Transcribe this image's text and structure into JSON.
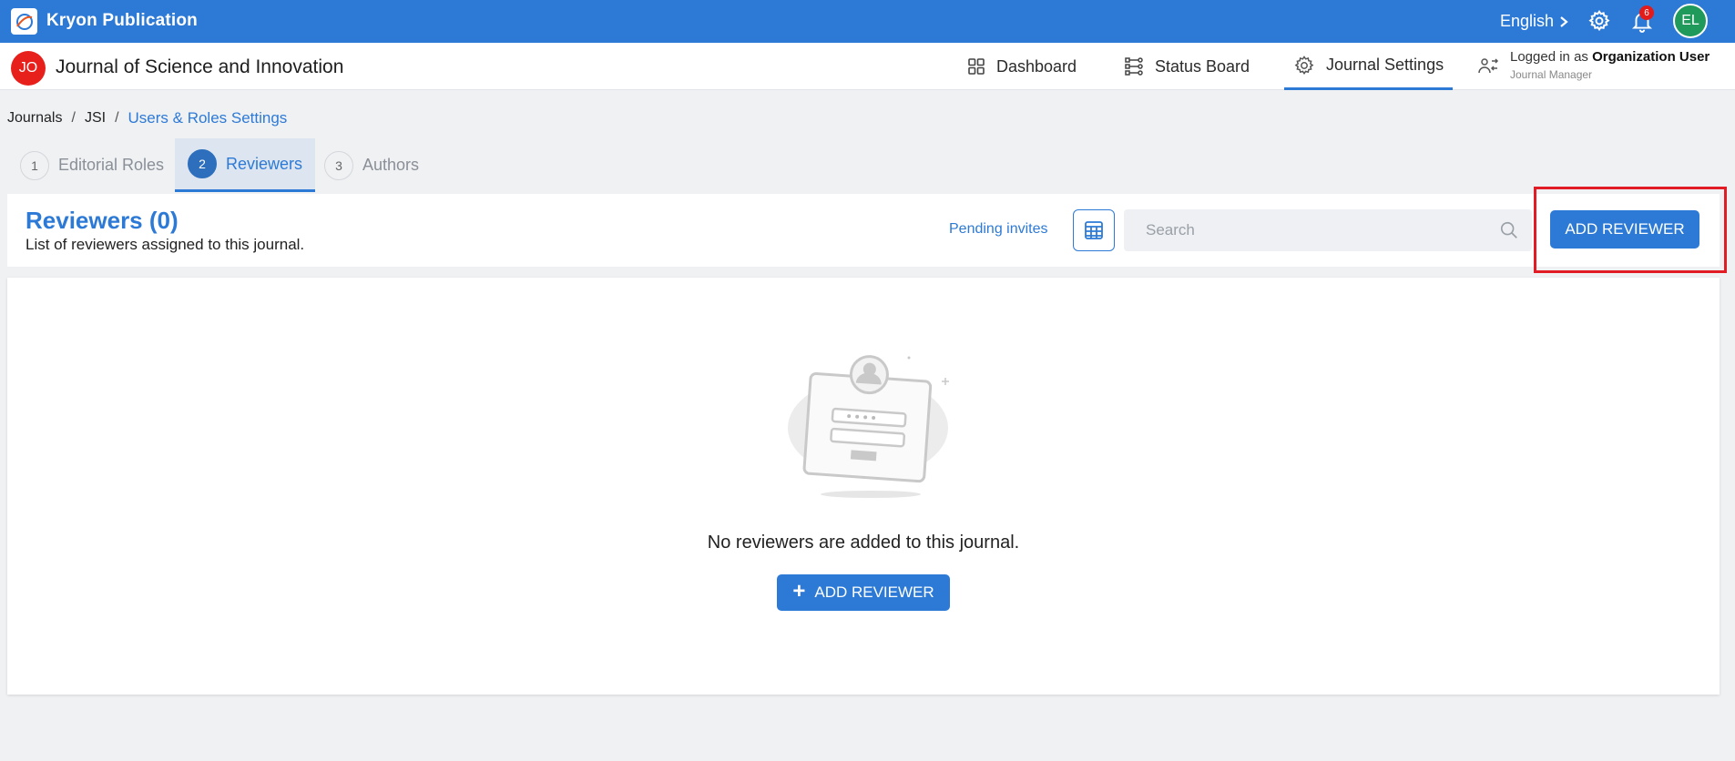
{
  "topbar": {
    "app_title": "Kryon Publication",
    "language": "English",
    "notification_count": "6",
    "user_initials": "EL"
  },
  "journal": {
    "badge": "JO",
    "title": "Journal of Science and Innovation"
  },
  "nav": {
    "dashboard": "Dashboard",
    "status_board": "Status Board",
    "journal_settings": "Journal Settings"
  },
  "login": {
    "prefix": "Logged in as",
    "user": "Organization User",
    "role": "Journal Manager"
  },
  "breadcrumb": {
    "items": [
      "Journals",
      "JSI",
      "Users & Roles Settings"
    ]
  },
  "tabs": [
    {
      "num": "1",
      "label": "Editorial Roles"
    },
    {
      "num": "2",
      "label": "Reviewers"
    },
    {
      "num": "3",
      "label": "Authors"
    }
  ],
  "panel": {
    "title": "Reviewers (0)",
    "subtitle": "List of reviewers assigned to this journal.",
    "pending_invites": "Pending invites",
    "search_placeholder": "Search",
    "add_button": "ADD REVIEWER"
  },
  "empty_state": {
    "message": "No reviewers are added to this journal.",
    "add_button": "ADD REVIEWER"
  },
  "colors": {
    "primary": "#2d7ad6",
    "highlight": "#e21c24",
    "journal_badge": "#e8201c",
    "avatar": "#1f9a5b"
  }
}
